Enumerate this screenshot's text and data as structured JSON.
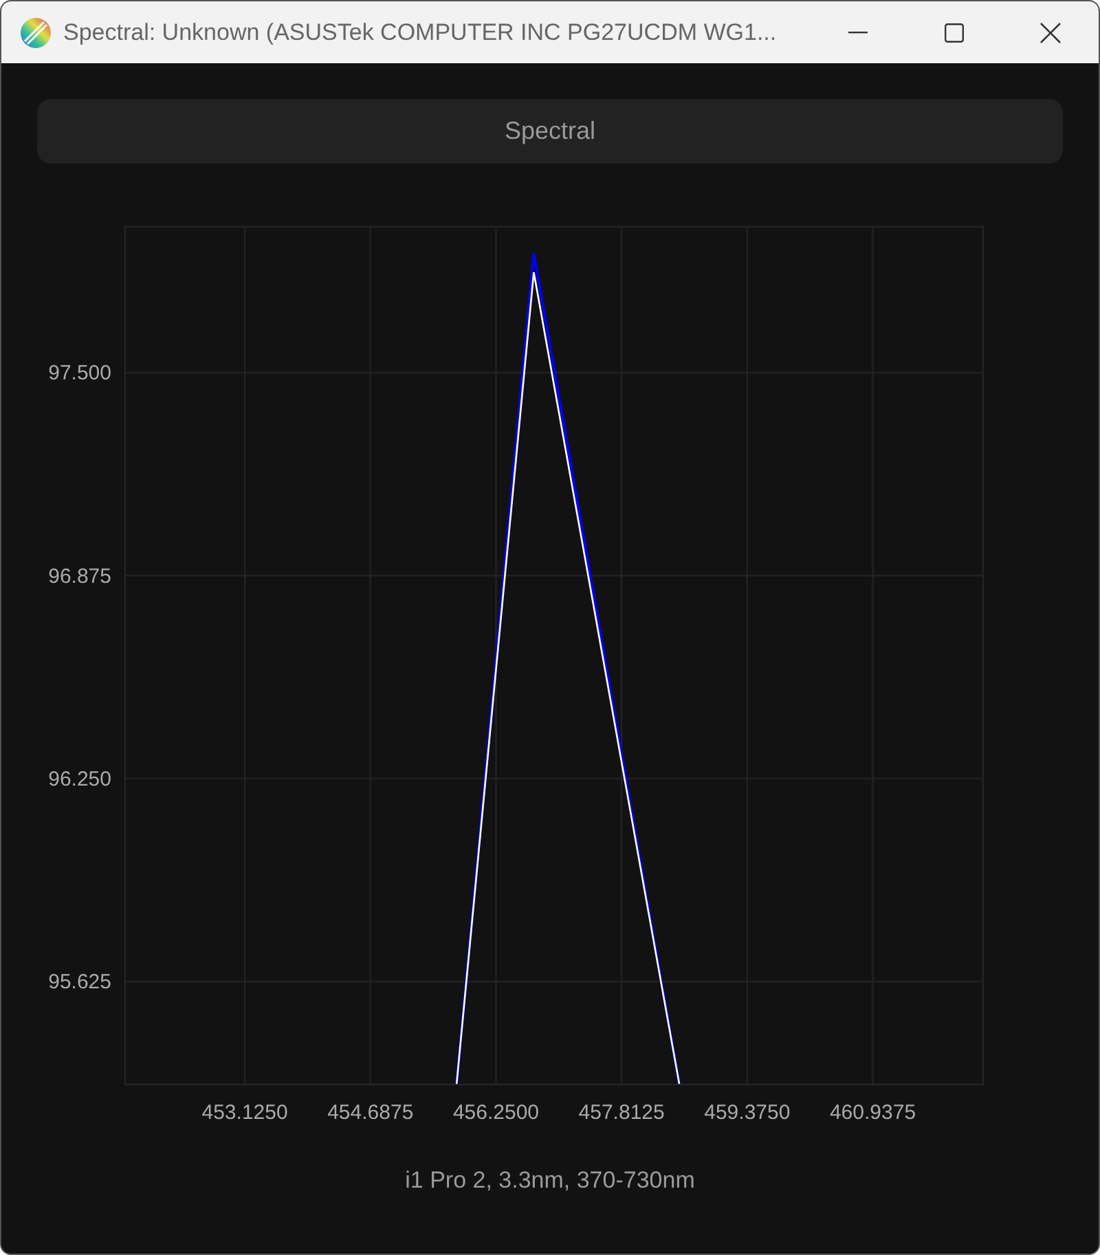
{
  "window": {
    "title": "Spectral: Unknown (ASUSTek COMPUTER INC PG27UCDM WG1..."
  },
  "mode_button": {
    "label": "Spectral"
  },
  "chart": {
    "chart_data": {
      "type": "line",
      "x": [
        455.76,
        456.72,
        458.53
      ],
      "grid": true,
      "series": [
        {
          "color": "#0000ff",
          "values": [
            95.31,
            97.868,
            95.31
          ]
        },
        {
          "color": "#ffffff",
          "values": [
            95.31,
            97.809,
            95.31
          ]
        }
      ],
      "xlim": [
        451.636,
        462.31
      ],
      "ylim": [
        95.308,
        97.949
      ],
      "xticks": [
        {
          "value": 453.125,
          "label": "453.1250"
        },
        {
          "value": 454.6875,
          "label": "454.6875"
        },
        {
          "value": 456.25,
          "label": "456.2500"
        },
        {
          "value": 457.8125,
          "label": "457.8125"
        },
        {
          "value": 459.375,
          "label": "459.3750"
        },
        {
          "value": 460.9375,
          "label": "460.9375"
        }
      ],
      "yticks": [
        {
          "value": 95.625,
          "label": "95.625"
        },
        {
          "value": 96.25,
          "label": "96.250"
        },
        {
          "value": 96.875,
          "label": "96.875"
        },
        {
          "value": 97.5,
          "label": "97.500"
        }
      ]
    }
  },
  "footer": {
    "text": "i1 Pro 2, 3.3nm, 370-730nm"
  }
}
